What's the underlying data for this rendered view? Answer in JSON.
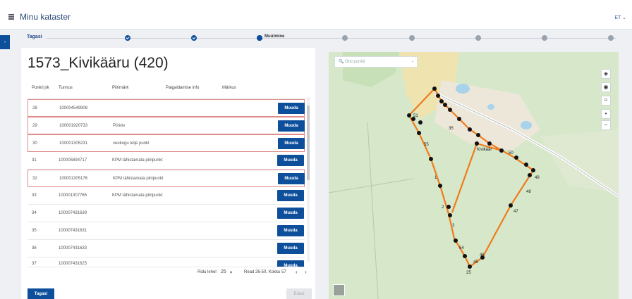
{
  "header": {
    "title": "Minu kataster",
    "lang": "ET ⌄"
  },
  "side_tab": "›",
  "stepper": {
    "back_label": "Tagasi",
    "active_label": "Muutmine"
  },
  "page_title": "1573_Kivikääru (420)",
  "table": {
    "columns": [
      "Punkti jrk",
      "Tunnus",
      "Piirimärk",
      "Paigaldamise info",
      "Märkus"
    ],
    "rows": [
      {
        "jrk": "28",
        "tunnus": "100004549908",
        "piirimark": "",
        "button": "Muuda"
      },
      {
        "jrk": "29",
        "tunnus": "100001920733",
        "piirimark": "Piiriviv",
        "button": "Muuda"
      },
      {
        "jrk": "30",
        "tunnus": "100001305231",
        "piirimark": "veekogu telje punkt",
        "button": "Muuda"
      },
      {
        "jrk": "31",
        "tunnus": "100005894717",
        "piirimark": "KPM tähistamata piiripunkt",
        "button": "Muuda"
      },
      {
        "jrk": "32",
        "tunnus": "100001305176",
        "piirimark": "KPM tähistamata piiripunkt",
        "button": "Muuda"
      },
      {
        "jrk": "33",
        "tunnus": "100001307765",
        "piirimark": "KPM tähistamata piiripunkt",
        "button": "Muuda"
      },
      {
        "jrk": "34",
        "tunnus": "100007431639",
        "piirimark": "",
        "button": "Muuda"
      },
      {
        "jrk": "35",
        "tunnus": "100007431631",
        "piirimark": "",
        "button": "Muuda"
      },
      {
        "jrk": "36",
        "tunnus": "100007431633",
        "piirimark": "",
        "button": "Muuda"
      },
      {
        "jrk": "37",
        "tunnus": "100007431625",
        "piirimark": "",
        "button": "Muuda"
      }
    ]
  },
  "pager": {
    "rows_label": "Ridu lehel",
    "rows_value": "25",
    "range": "Read 26-50, Kokku 57",
    "prev": "‹",
    "next": "›"
  },
  "footer": {
    "back": "Tagasi",
    "next": "Edasi"
  },
  "map": {
    "search_placeholder": "Otsi punkti",
    "search_icon": "🔍",
    "chevron": "⌄",
    "controls": [
      "◈",
      "◉",
      "⌑",
      "•",
      "−"
    ],
    "point_labels": [
      "51",
      "52",
      "53",
      "1",
      "2",
      "3",
      "46",
      "47",
      "48",
      "49",
      "50",
      "54",
      "55",
      "56",
      "57",
      "25",
      "26",
      "27",
      "28",
      "35",
      "36",
      "45",
      "43",
      "42",
      "Kivikäär"
    ]
  },
  "colors": {
    "primary": "#0e4f9c",
    "boundary": "#f07a1c",
    "map_bg": "#d6e8c9"
  }
}
